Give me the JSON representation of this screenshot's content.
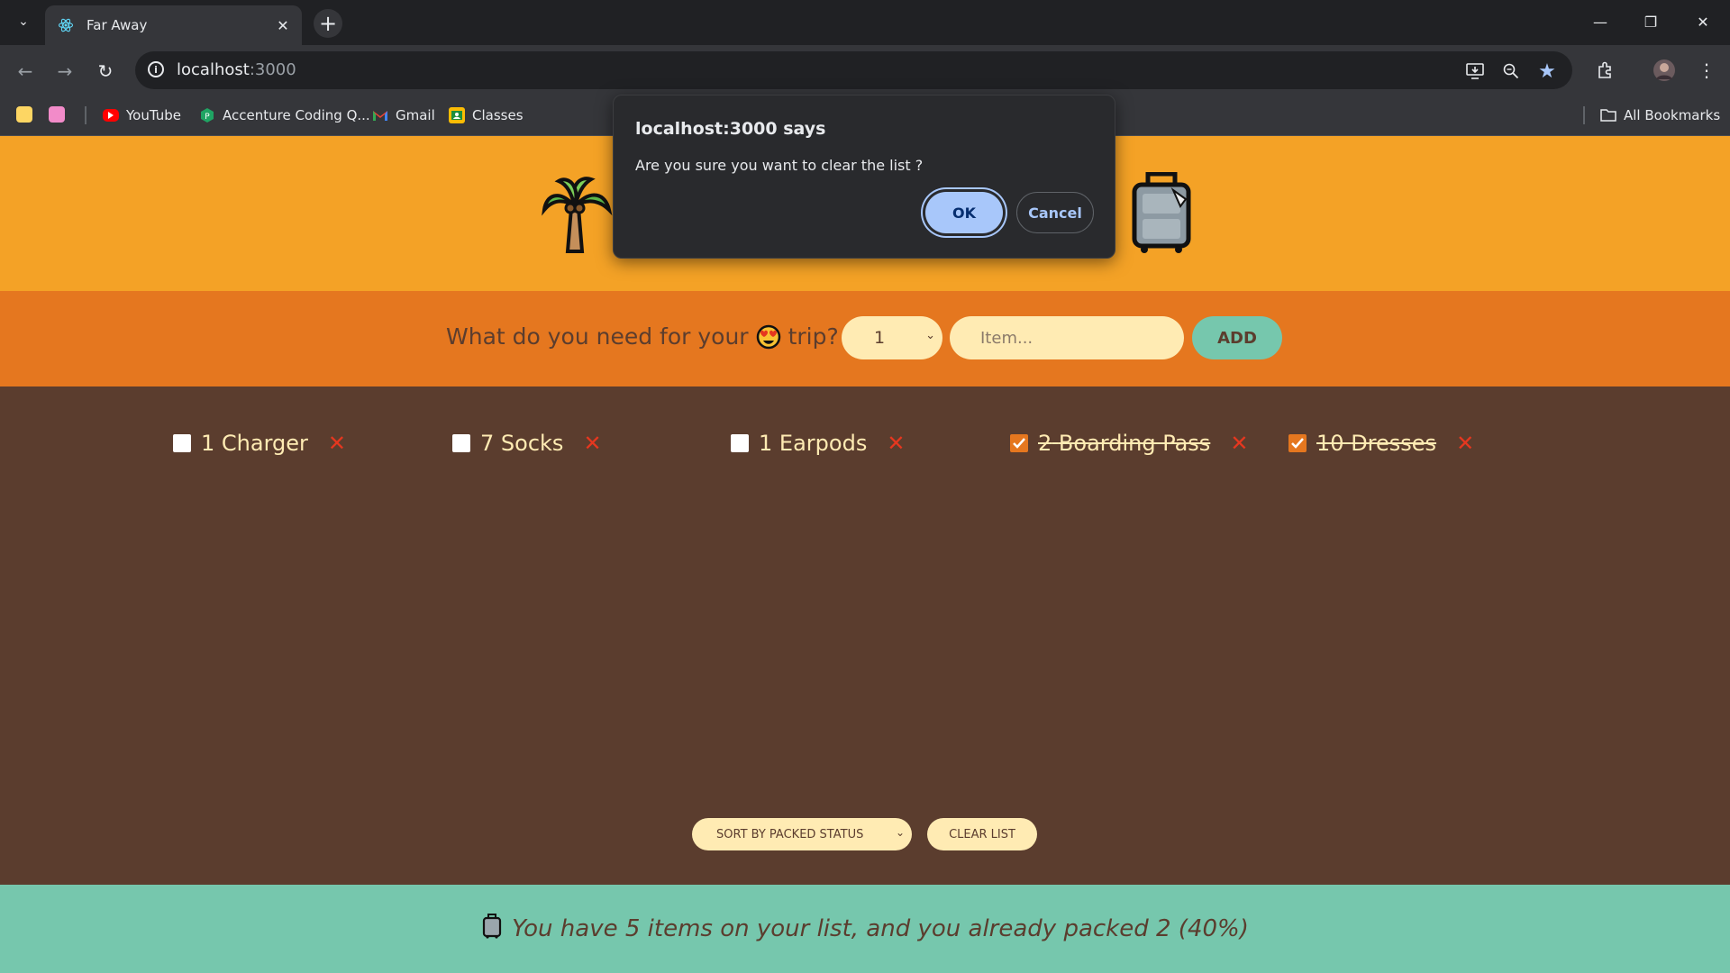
{
  "browser": {
    "tab_title": "Far Away",
    "url_host": "localhost",
    "url_port": ":3000",
    "bookmarks": [
      {
        "label": "YouTube",
        "icon": "youtube-icon"
      },
      {
        "label": "Accenture Coding Q...",
        "icon": "accenture-icon"
      },
      {
        "label": "Gmail",
        "icon": "gmail-icon"
      },
      {
        "label": "Classes",
        "icon": "classes-icon"
      }
    ],
    "all_bookmarks": "All Bookmarks"
  },
  "form": {
    "question_before": "What do you need for your",
    "question_after": "trip?",
    "quantity_value": "1",
    "item_placeholder": "Item...",
    "add_label": "ADD"
  },
  "items": [
    {
      "qty": "1",
      "name": "Charger",
      "packed": false
    },
    {
      "qty": "7",
      "name": "Socks",
      "packed": false
    },
    {
      "qty": "1",
      "name": "Earpods",
      "packed": false
    },
    {
      "qty": "2",
      "name": "Boarding Pass",
      "packed": true
    },
    {
      "qty": "10",
      "name": "Dresses",
      "packed": true
    }
  ],
  "actions": {
    "sort_label": "SORT BY PACKED STATUS",
    "clear_label": "CLEAR LIST"
  },
  "stats": {
    "text": "You have 5 items on your list, and you already packed 2 (40%)"
  },
  "dialog": {
    "title": "localhost:3000 says",
    "message": "Are you sure you want to clear the list ?",
    "ok_label": "OK",
    "cancel_label": "Cancel"
  },
  "colors": {
    "header_bg": "#f4a226",
    "form_bg": "#e5771f",
    "list_bg": "#5b3d2e",
    "stats_bg": "#76c7ad",
    "cream": "#ffebb3"
  }
}
